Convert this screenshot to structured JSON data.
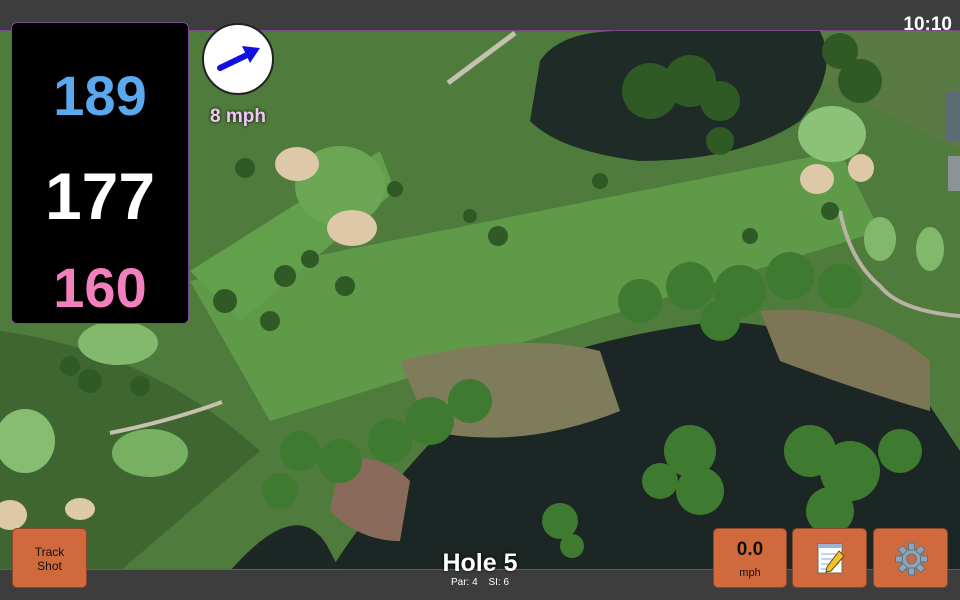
{
  "status": {
    "time": "10:10"
  },
  "distances": {
    "back": "189",
    "center": "177",
    "front": "160"
  },
  "wind": {
    "speed_label": "8 mph",
    "arrow_icon": "wind-direction-arrow-icon"
  },
  "buttons": {
    "track_shot": {
      "line1": "Track",
      "line2": "Shot"
    },
    "wind_reading": {
      "value": "0.0",
      "unit": "mph"
    },
    "notes_icon": "notepad-icon",
    "settings_icon": "gear-icon"
  },
  "hole": {
    "title": "Hole 5",
    "par": "Par: 4",
    "si": "SI: 6"
  },
  "colors": {
    "back_distance": "#5aa8ee",
    "center_distance": "#ffffff",
    "front_distance": "#f47fbe",
    "button": "#d06a3c",
    "wind_arrow": "#1010e0"
  }
}
